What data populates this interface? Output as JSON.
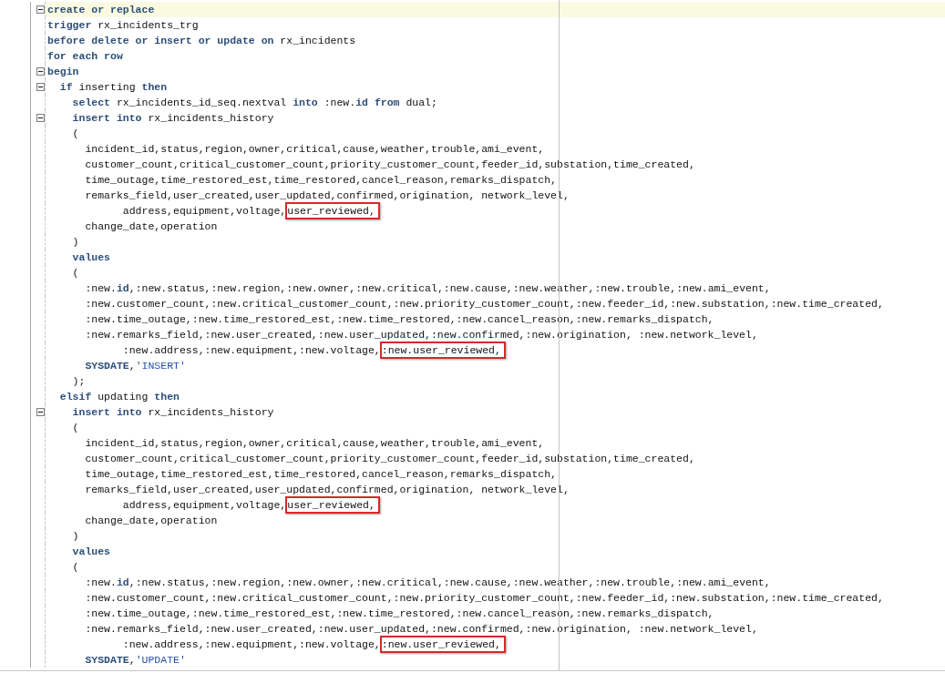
{
  "editor": {
    "lines": [
      {
        "fold": true,
        "current": true,
        "segments": [
          {
            "kind": "keyword",
            "text": "create or replace"
          }
        ]
      },
      {
        "fold": false,
        "current": false,
        "segments": [
          {
            "kind": "keyword",
            "text": "trigger"
          },
          {
            "kind": "plain",
            "text": " rx_incidents_trg"
          }
        ]
      },
      {
        "fold": false,
        "current": false,
        "segments": [
          {
            "kind": "keyword",
            "text": "before delete or insert or update on"
          },
          {
            "kind": "plain",
            "text": " rx_incidents"
          }
        ]
      },
      {
        "fold": false,
        "current": false,
        "segments": [
          {
            "kind": "keyword",
            "text": "for each row"
          }
        ]
      },
      {
        "fold": true,
        "current": false,
        "segments": [
          {
            "kind": "keyword",
            "text": "begin"
          }
        ]
      },
      {
        "fold": true,
        "current": false,
        "segments": [
          {
            "kind": "keyword",
            "text": "  if"
          },
          {
            "kind": "plain",
            "text": " inserting "
          },
          {
            "kind": "keyword",
            "text": "then"
          }
        ]
      },
      {
        "fold": false,
        "current": false,
        "segments": [
          {
            "kind": "keyword",
            "text": "    select"
          },
          {
            "kind": "plain",
            "text": " rx_incidents_id_seq.nextval "
          },
          {
            "kind": "keyword",
            "text": "into"
          },
          {
            "kind": "plain",
            "text": " :new."
          },
          {
            "kind": "keyword",
            "text": "id"
          },
          {
            "kind": "keyword",
            "text": " from"
          },
          {
            "kind": "plain",
            "text": " dual;"
          }
        ]
      },
      {
        "fold": true,
        "current": false,
        "segments": [
          {
            "kind": "keyword",
            "text": "    insert into"
          },
          {
            "kind": "plain",
            "text": " rx_incidents_history"
          }
        ]
      },
      {
        "fold": false,
        "current": false,
        "segments": [
          {
            "kind": "plain",
            "text": "    ("
          }
        ]
      },
      {
        "fold": false,
        "current": false,
        "segments": [
          {
            "kind": "plain",
            "text": "      incident_id,status,region,owner,critical,cause,weather,trouble,ami_event,"
          }
        ]
      },
      {
        "fold": false,
        "current": false,
        "segments": [
          {
            "kind": "plain",
            "text": "      customer_count,critical_customer_count,priority_customer_count,feeder_id,substation,time_created,"
          }
        ]
      },
      {
        "fold": false,
        "current": false,
        "segments": [
          {
            "kind": "plain",
            "text": "      time_outage,time_restored_est,time_restored,cancel_reason,remarks_dispatch,"
          }
        ]
      },
      {
        "fold": false,
        "current": false,
        "segments": [
          {
            "kind": "plain",
            "text": "      remarks_field,user_created,user_updated,confirmed,origination, network_level,"
          }
        ]
      },
      {
        "fold": false,
        "current": false,
        "segments": [
          {
            "kind": "plain",
            "text": "            address,equipment,voltage,"
          },
          {
            "kind": "boxed",
            "text": "user_reviewed,"
          }
        ]
      },
      {
        "fold": false,
        "current": false,
        "segments": [
          {
            "kind": "plain",
            "text": "      change_date,operation"
          }
        ]
      },
      {
        "fold": false,
        "current": false,
        "segments": [
          {
            "kind": "plain",
            "text": "    )"
          }
        ]
      },
      {
        "fold": false,
        "current": false,
        "segments": [
          {
            "kind": "keyword",
            "text": "    values"
          }
        ]
      },
      {
        "fold": false,
        "current": false,
        "segments": [
          {
            "kind": "plain",
            "text": "    ("
          }
        ]
      },
      {
        "fold": false,
        "current": false,
        "segments": [
          {
            "kind": "plain",
            "text": "      :new."
          },
          {
            "kind": "keyword",
            "text": "id"
          },
          {
            "kind": "plain",
            "text": ",:new.status,:new.region,:new.owner,:new.critical,:new.cause,:new.weather,:new.trouble,:new.ami_event,"
          }
        ]
      },
      {
        "fold": false,
        "current": false,
        "segments": [
          {
            "kind": "plain",
            "text": "      :new.customer_count,:new.critical_customer_count,:new.priority_customer_count,:new.feeder_id,:new.substation,:new.time_created,"
          }
        ]
      },
      {
        "fold": false,
        "current": false,
        "segments": [
          {
            "kind": "plain",
            "text": "      :new.time_outage,:new.time_restored_est,:new.time_restored,:new.cancel_reason,:new.remarks_dispatch,"
          }
        ]
      },
      {
        "fold": false,
        "current": false,
        "segments": [
          {
            "kind": "plain",
            "text": "      :new.remarks_field,:new.user_created,:new.user_updated,:new.confirmed,:new.origination, :new.network_level,"
          }
        ]
      },
      {
        "fold": false,
        "current": false,
        "segments": [
          {
            "kind": "plain",
            "text": "            :new.address,:new.equipment,:new.voltage,"
          },
          {
            "kind": "boxed",
            "text": ":new.user_reviewed,"
          }
        ]
      },
      {
        "fold": false,
        "current": false,
        "segments": [
          {
            "kind": "keyword",
            "text": "      SYSDATE"
          },
          {
            "kind": "plain",
            "text": ","
          },
          {
            "kind": "string",
            "text": "'INSERT'"
          }
        ]
      },
      {
        "fold": false,
        "current": false,
        "segments": [
          {
            "kind": "plain",
            "text": "    );"
          }
        ]
      },
      {
        "fold": false,
        "current": false,
        "segments": [
          {
            "kind": "keyword",
            "text": "  elsif"
          },
          {
            "kind": "plain",
            "text": " updating "
          },
          {
            "kind": "keyword",
            "text": "then"
          }
        ]
      },
      {
        "fold": true,
        "current": false,
        "segments": [
          {
            "kind": "keyword",
            "text": "    insert into"
          },
          {
            "kind": "plain",
            "text": " rx_incidents_history"
          }
        ]
      },
      {
        "fold": false,
        "current": false,
        "segments": [
          {
            "kind": "plain",
            "text": "    ("
          }
        ]
      },
      {
        "fold": false,
        "current": false,
        "segments": [
          {
            "kind": "plain",
            "text": "      incident_id,status,region,owner,critical,cause,weather,trouble,ami_event,"
          }
        ]
      },
      {
        "fold": false,
        "current": false,
        "segments": [
          {
            "kind": "plain",
            "text": "      customer_count,critical_customer_count,priority_customer_count,feeder_id,substation,time_created,"
          }
        ]
      },
      {
        "fold": false,
        "current": false,
        "segments": [
          {
            "kind": "plain",
            "text": "      time_outage,time_restored_est,time_restored,cancel_reason,remarks_dispatch,"
          }
        ]
      },
      {
        "fold": false,
        "current": false,
        "segments": [
          {
            "kind": "plain",
            "text": "      remarks_field,user_created,user_updated,confirmed,origination, network_level,"
          }
        ]
      },
      {
        "fold": false,
        "current": false,
        "segments": [
          {
            "kind": "plain",
            "text": "            address,equipment,voltage,"
          },
          {
            "kind": "boxed",
            "text": "user_reviewed,"
          }
        ]
      },
      {
        "fold": false,
        "current": false,
        "segments": [
          {
            "kind": "plain",
            "text": "      change_date,operation"
          }
        ]
      },
      {
        "fold": false,
        "current": false,
        "segments": [
          {
            "kind": "plain",
            "text": "    )"
          }
        ]
      },
      {
        "fold": false,
        "current": false,
        "segments": [
          {
            "kind": "keyword",
            "text": "    values"
          }
        ]
      },
      {
        "fold": false,
        "current": false,
        "segments": [
          {
            "kind": "plain",
            "text": "    ("
          }
        ]
      },
      {
        "fold": false,
        "current": false,
        "segments": [
          {
            "kind": "plain",
            "text": "      :new."
          },
          {
            "kind": "keyword",
            "text": "id"
          },
          {
            "kind": "plain",
            "text": ",:new.status,:new.region,:new.owner,:new.critical,:new.cause,:new.weather,:new.trouble,:new.ami_event,"
          }
        ]
      },
      {
        "fold": false,
        "current": false,
        "segments": [
          {
            "kind": "plain",
            "text": "      :new.customer_count,:new.critical_customer_count,:new.priority_customer_count,:new.feeder_id,:new.substation,:new.time_created,"
          }
        ]
      },
      {
        "fold": false,
        "current": false,
        "segments": [
          {
            "kind": "plain",
            "text": "      :new.time_outage,:new.time_restored_est,:new.time_restored,:new.cancel_reason,:new.remarks_dispatch,"
          }
        ]
      },
      {
        "fold": false,
        "current": false,
        "segments": [
          {
            "kind": "plain",
            "text": "      :new.remarks_field,:new.user_created,:new.user_updated,:new.confirmed,:new.origination, :new.network_level,"
          }
        ]
      },
      {
        "fold": false,
        "current": false,
        "segments": [
          {
            "kind": "plain",
            "text": "            :new.address,:new.equipment,:new.voltage,"
          },
          {
            "kind": "boxed",
            "text": ":new.user_reviewed,"
          }
        ]
      },
      {
        "fold": false,
        "current": false,
        "segments": [
          {
            "kind": "keyword",
            "text": "      SYSDATE"
          },
          {
            "kind": "plain",
            "text": ","
          },
          {
            "kind": "string",
            "text": "'UPDATE'"
          }
        ]
      }
    ]
  }
}
